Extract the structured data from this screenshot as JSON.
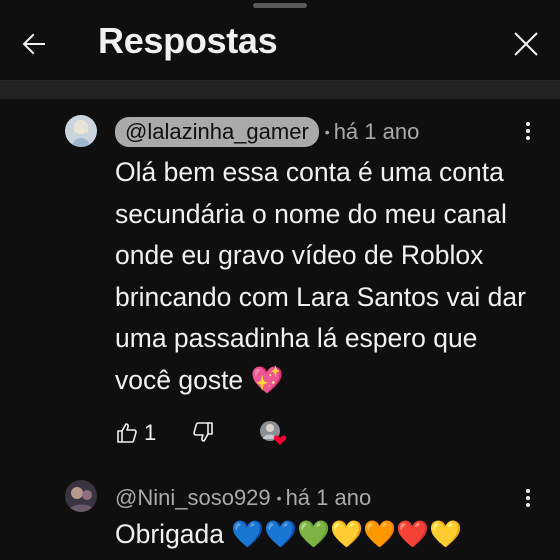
{
  "header": {
    "title": "Respostas",
    "back_icon": "arrow-left-icon",
    "close_icon": "close-icon"
  },
  "comments": [
    {
      "author": "@lalazinha_gamer",
      "time": "há 1 ano",
      "text": "Olá bem essa conta é uma conta secundária o nome do meu canal onde eu gravo vídeo de Roblox brincando com Lara Santos vai dar uma passadinha lá espero que você goste 💖",
      "likes": "1",
      "creator_heart": true
    },
    {
      "author": "@Nini_soso929",
      "time": "há 1 ano",
      "text": "Obrigada 💙💙💚💛🧡❤️💛"
    }
  ],
  "colors": {
    "background": "#0f0f0f",
    "secondary_text": "#aaaaaa",
    "heart": "#ff0033"
  }
}
